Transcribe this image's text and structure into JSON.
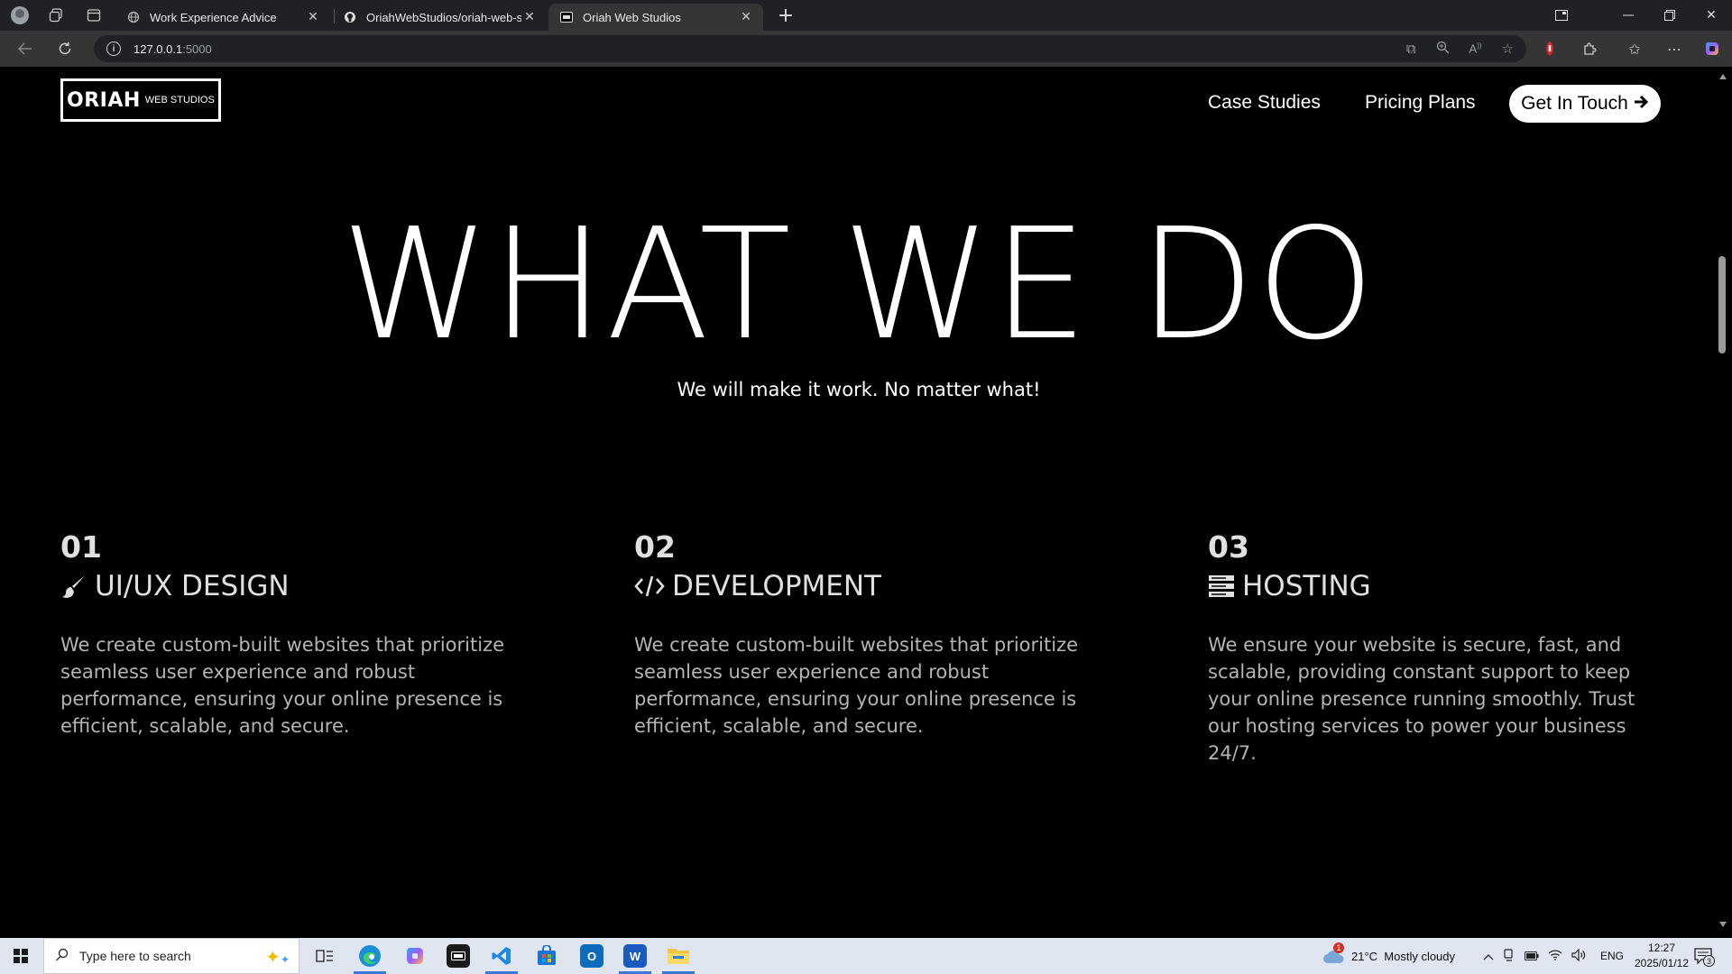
{
  "browser": {
    "tabs": [
      {
        "title": "Work Experience Advice",
        "favicon": "globe-icon",
        "active": false
      },
      {
        "title": "OriahWebStudios/oriah-web-stud",
        "favicon": "github-icon",
        "active": false
      },
      {
        "title": "Oriah Web Studios",
        "favicon": "site-icon",
        "active": true
      }
    ],
    "url_host": "127.0.0.1",
    "url_port": ":5000"
  },
  "site": {
    "logo_main": "ORIAH",
    "logo_sub": "WEB STUDIOS",
    "nav": {
      "case_studies": "Case Studies",
      "pricing_plans": "Pricing Plans",
      "cta": "Get In Touch"
    },
    "hero": {
      "title": "WHAT WE DO",
      "subtitle": "We will make it work. No matter what!"
    },
    "services": [
      {
        "number": "01",
        "icon": "paintbrush-icon",
        "title": "UI/UX DESIGN",
        "description": "We create custom-built websites that prioritize seamless user experience and robust performance, ensuring your online presence is efficient, scalable, and secure."
      },
      {
        "number": "02",
        "icon": "code-icon",
        "title": "DEVELOPMENT",
        "description": "We create custom-built websites that prioritize seamless user experience and robust performance, ensuring your online presence is efficient, scalable, and secure."
      },
      {
        "number": "03",
        "icon": "server-icon",
        "title": "HOSTING",
        "description": "We ensure your website is secure, fast, and scalable, providing constant support to keep your online presence running smoothly. Trust our hosting services to power your business 24/7."
      }
    ]
  },
  "taskbar": {
    "search_placeholder": "Type here to search",
    "weather": "21°C  Mostly cloudy",
    "weather_badge": "1",
    "language": "ENG",
    "time": "12:27",
    "date": "2025/01/12",
    "notification_count": "3"
  },
  "colors": {
    "page_bg": "#000000",
    "text": "#ffffff",
    "muted_text": "#b4b4b4",
    "chrome_dark": "#202124",
    "chrome_mid": "#353535",
    "taskbar": "#dfe6f1"
  }
}
